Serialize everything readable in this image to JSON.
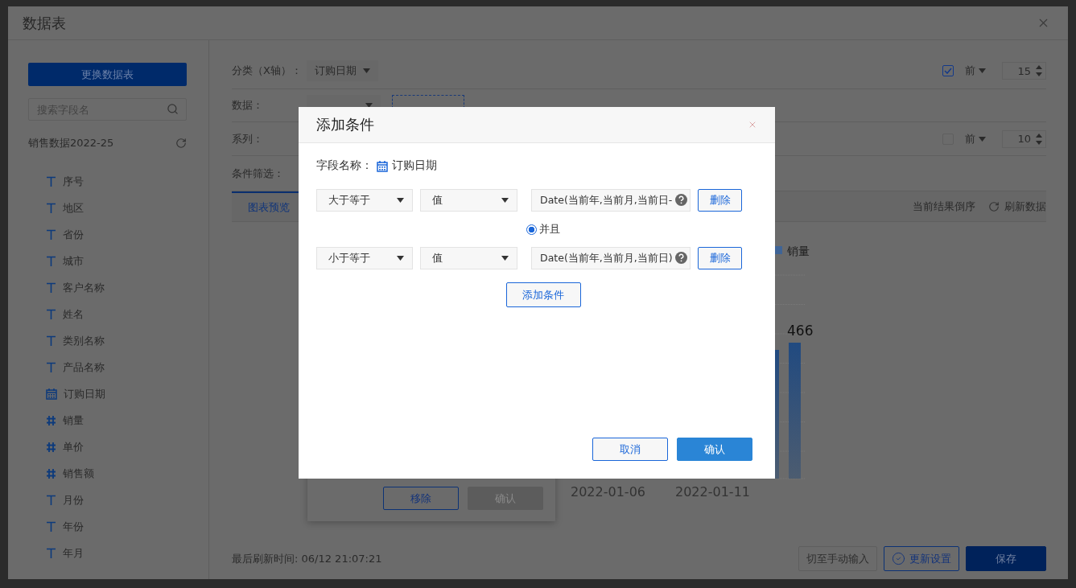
{
  "window": {
    "title": "数据表"
  },
  "sidebar": {
    "change_button": "更换数据表",
    "search": {
      "placeholder": "搜索字段名"
    },
    "dataset": "销售数据2022-25",
    "fields": [
      {
        "kind": "text",
        "label": "序号"
      },
      {
        "kind": "text",
        "label": "地区"
      },
      {
        "kind": "text",
        "label": "省份"
      },
      {
        "kind": "text",
        "label": "城市"
      },
      {
        "kind": "text",
        "label": "客户名称"
      },
      {
        "kind": "text",
        "label": "姓名"
      },
      {
        "kind": "text",
        "label": "类别名称"
      },
      {
        "kind": "text",
        "label": "产品名称"
      },
      {
        "kind": "date",
        "label": "订购日期"
      },
      {
        "kind": "number",
        "label": "销量"
      },
      {
        "kind": "number",
        "label": "单价"
      },
      {
        "kind": "number",
        "label": "销售额"
      },
      {
        "kind": "text",
        "label": "月份"
      },
      {
        "kind": "text",
        "label": "年份"
      },
      {
        "kind": "text",
        "label": "年月"
      }
    ]
  },
  "settings": {
    "rows": [
      {
        "kind": "category",
        "label": "分类（X轴）：",
        "chips": [
          "订购日期"
        ],
        "top_n": {
          "checked": true,
          "mode": "前",
          "count": "15"
        }
      },
      {
        "kind": "data",
        "label": "数据："
      },
      {
        "kind": "series",
        "label": "系列：",
        "top_n": {
          "checked": false,
          "mode": "前",
          "count": "10"
        }
      },
      {
        "kind": "filter",
        "label": "条件筛选："
      }
    ]
  },
  "tabs": [
    {
      "label": "图表预览",
      "selected": true
    }
  ],
  "toolbar": {
    "reverse": "当前结果倒序",
    "refresh": "刷新数据"
  },
  "chart": {
    "legend": "销量",
    "value_label": "466",
    "x_labels": [
      "2022-01-06",
      "2022-01-11"
    ]
  },
  "popover": {
    "buttons": [
      {
        "label": "移除",
        "disabled": false
      },
      {
        "label": "确认",
        "disabled": true
      }
    ]
  },
  "footer": {
    "refresh_time": "最后刷新时间: 06/12 21:07:21",
    "buttons": [
      {
        "kind": "plain",
        "label": "切至手动输入"
      },
      {
        "kind": "outline",
        "label": "更新设置"
      },
      {
        "kind": "primary",
        "label": "保存"
      }
    ]
  },
  "modal": {
    "title": "添加条件",
    "field_label": "字段名称：",
    "field_name": "订购日期",
    "conditions": [
      {
        "operator": "大于等于",
        "value_type": "值",
        "value": "Date(当前年,当前月,当前日-",
        "delete": "删除"
      },
      {
        "operator": "小于等于",
        "value_type": "值",
        "value": "Date(当前年,当前月,当前日)",
        "delete": "删除"
      }
    ],
    "join": {
      "label": "并且",
      "selected": true
    },
    "add_button": "添加条件",
    "cancel": "取消",
    "confirm": "确认"
  }
}
